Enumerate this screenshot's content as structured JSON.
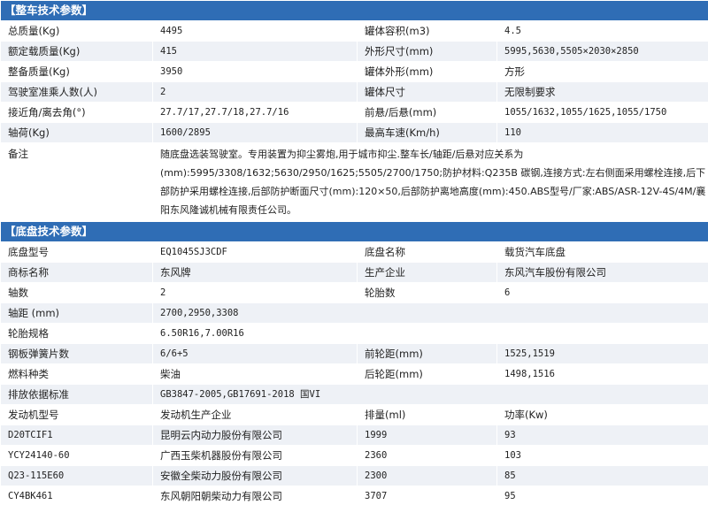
{
  "vehicle": {
    "header": "【整车技术参数】",
    "rows": [
      [
        "总质量(Kg)",
        "4495",
        "罐体容积(m3)",
        "4.5"
      ],
      [
        "额定载质量(Kg)",
        "415",
        "外形尺寸(mm)",
        "5995,5630,5505×2030×2850"
      ],
      [
        "整备质量(Kg)",
        "3950",
        "罐体外形(mm)",
        "方形"
      ],
      [
        "驾驶室准乘人数(人)",
        "2",
        "罐体尺寸",
        "无限制要求"
      ],
      [
        "接近角/离去角(°)",
        "27.7/17,27.7/18,27.7/16",
        "前悬/后悬(mm)",
        "1055/1632,1055/1625,1055/1750"
      ],
      [
        "轴荷(Kg)",
        "1600/2895",
        "最高车速(Km/h)",
        "110"
      ]
    ],
    "note_label": "备注",
    "note_text": "随底盘选装驾驶室。专用装置为抑尘雾炮,用于城市抑尘.整车长/轴距/后悬对应关系为(mm):5995/3308/1632;5630/2950/1625;5505/2700/1750;防护材料:Q235B 碳钢,连接方式:左右侧面采用螺栓连接,后下部防护采用螺栓连接,后部防护断面尺寸(mm):120×50,后部防护离地高度(mm):450.ABS型号/厂家:ABS/ASR-12V-4S/4M/襄阳东风隆诚机械有限责任公司。"
  },
  "chassis": {
    "header": "【底盘技术参数】",
    "rows4": [
      [
        "底盘型号",
        "EQ1045SJ3CDF",
        "底盘名称",
        "载货汽车底盘"
      ],
      [
        "商标名称",
        "东风牌",
        "生产企业",
        "东风汽车股份有限公司"
      ],
      [
        "轴数",
        "2",
        "轮胎数",
        "6"
      ]
    ],
    "wheelbase": [
      "轴距 (mm)",
      "2700,2950,3308"
    ],
    "tire": [
      "轮胎规格",
      "6.50R16,7.00R16"
    ],
    "rows4b": [
      [
        "钢板弹簧片数",
        "6/6+5",
        "前轮距(mm)",
        "1525,1519"
      ],
      [
        "燃料种类",
        "柴油",
        "后轮距(mm)",
        "1498,1516"
      ]
    ],
    "emission": [
      "排放依据标准",
      "GB3847-2005,GB17691-2018 国VI"
    ],
    "engine_header": [
      "发动机型号",
      "发动机生产企业",
      "排量(ml)",
      "功率(Kw)"
    ],
    "engines": [
      [
        "D20TCIF1",
        "昆明云内动力股份有限公司",
        "1999",
        "93"
      ],
      [
        "YCY24140-60",
        "广西玉柴机器股份有限公司",
        "2360",
        "103"
      ],
      [
        "Q23-115E60",
        "安徽全柴动力股份有限公司",
        "2300",
        "85"
      ],
      [
        "CY4BK461",
        "东风朝阳朝柴动力有限公司",
        "3707",
        "95"
      ]
    ]
  }
}
